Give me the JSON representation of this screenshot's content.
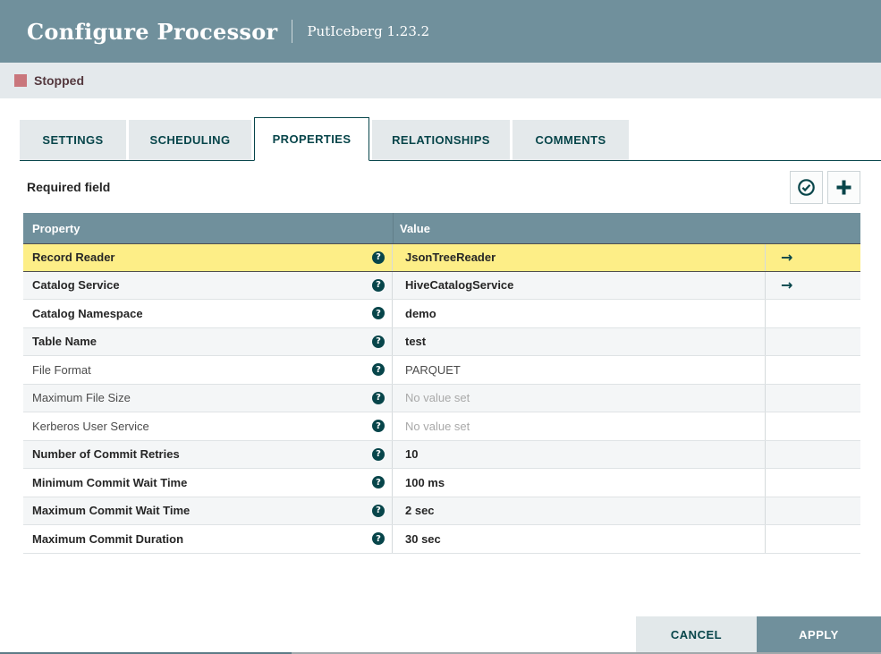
{
  "header": {
    "title": "Configure Processor",
    "subtitle": "PutIceberg 1.23.2"
  },
  "status": {
    "label": "Stopped"
  },
  "tabs": [
    {
      "label": "SETTINGS",
      "active": false
    },
    {
      "label": "SCHEDULING",
      "active": false
    },
    {
      "label": "PROPERTIES",
      "active": true
    },
    {
      "label": "RELATIONSHIPS",
      "active": false
    },
    {
      "label": "COMMENTS",
      "active": false
    }
  ],
  "toolbar": {
    "required_label": "Required field",
    "verify_button_icon": "check-circle-icon",
    "add_button_icon": "plus-icon"
  },
  "icons": {
    "help_glyph": "?",
    "arrow_glyph": "→"
  },
  "table": {
    "columns": [
      "Property",
      "Value"
    ],
    "rows": [
      {
        "property": "Record Reader",
        "value": "JsonTreeReader",
        "required": true,
        "empty": false,
        "selected": true,
        "has_arrow": true
      },
      {
        "property": "Catalog Service",
        "value": "HiveCatalogService",
        "required": true,
        "empty": false,
        "selected": false,
        "has_arrow": true
      },
      {
        "property": "Catalog Namespace",
        "value": "demo",
        "required": true,
        "empty": false,
        "selected": false,
        "has_arrow": false
      },
      {
        "property": "Table Name",
        "value": "test",
        "required": true,
        "empty": false,
        "selected": false,
        "has_arrow": false
      },
      {
        "property": "File Format",
        "value": "PARQUET",
        "required": false,
        "empty": false,
        "selected": false,
        "has_arrow": false
      },
      {
        "property": "Maximum File Size",
        "value": "No value set",
        "required": false,
        "empty": true,
        "selected": false,
        "has_arrow": false
      },
      {
        "property": "Kerberos User Service",
        "value": "No value set",
        "required": false,
        "empty": true,
        "selected": false,
        "has_arrow": false
      },
      {
        "property": "Number of Commit Retries",
        "value": "10",
        "required": true,
        "empty": false,
        "selected": false,
        "has_arrow": false
      },
      {
        "property": "Minimum Commit Wait Time",
        "value": "100 ms",
        "required": true,
        "empty": false,
        "selected": false,
        "has_arrow": false
      },
      {
        "property": "Maximum Commit Wait Time",
        "value": "2 sec",
        "required": true,
        "empty": false,
        "selected": false,
        "has_arrow": false
      },
      {
        "property": "Maximum Commit Duration",
        "value": "30 sec",
        "required": true,
        "empty": false,
        "selected": false,
        "has_arrow": false
      }
    ]
  },
  "footer": {
    "cancel_label": "CANCEL",
    "apply_label": "APPLY"
  },
  "colors": {
    "slate_header": "#70909c",
    "teal_accent": "#07454a",
    "selected_row": "#fdee87",
    "alt_row": "#f4f6f7",
    "status_bar_bg": "#e4e9ec",
    "stopped_square": "#c9767c",
    "stopped_text": "#54383e",
    "empty_value_text": "#a9a9a9"
  }
}
